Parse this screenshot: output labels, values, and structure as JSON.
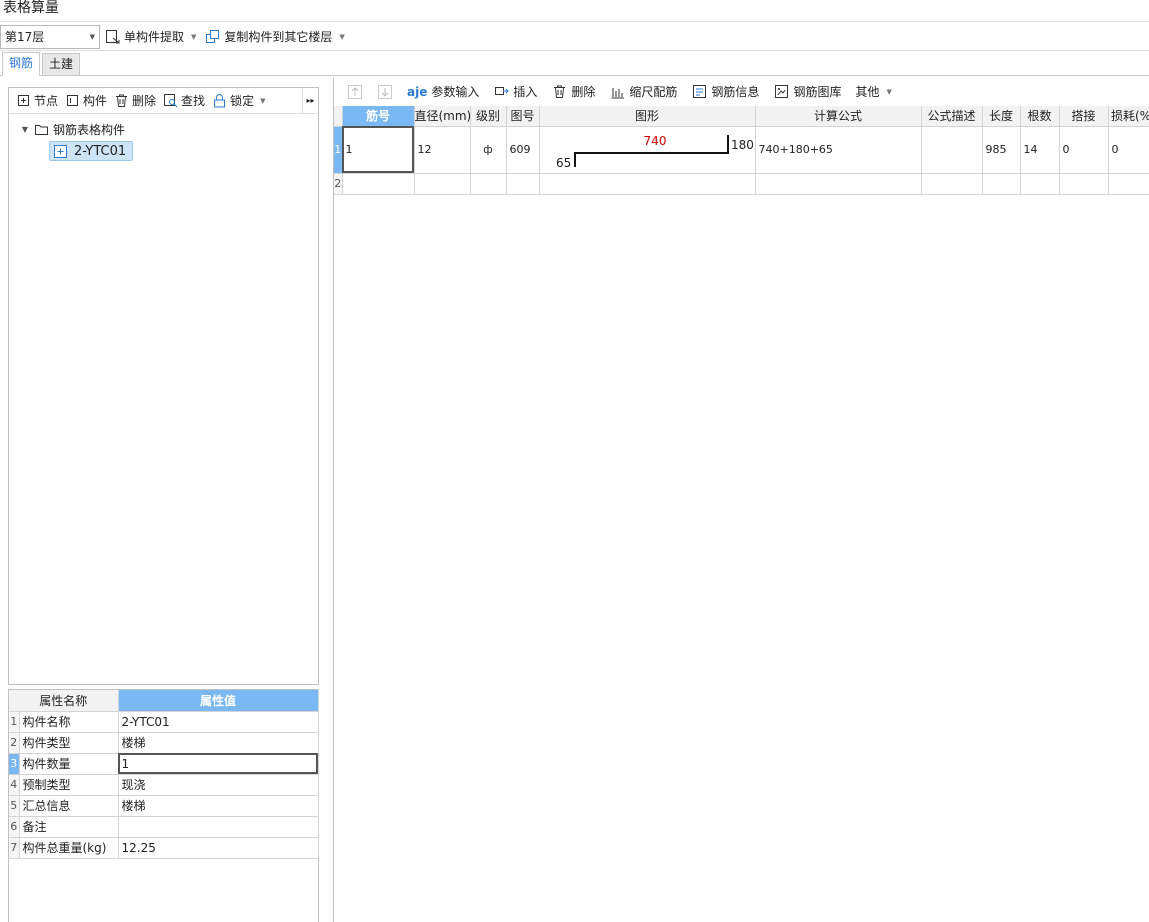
{
  "app": {
    "title": "表格算量"
  },
  "toolbar": {
    "floor": "第17层",
    "extract_label": "单构件提取",
    "copy_label": "复制构件到其它楼层"
  },
  "tabs": [
    {
      "label": "钢筋",
      "active": true
    },
    {
      "label": "土建",
      "active": false
    }
  ],
  "left_toolbar": {
    "node": "节点",
    "component": "构件",
    "delete": "删除",
    "find": "查找",
    "lock": "锁定"
  },
  "tree": {
    "root": "钢筋表格构件",
    "child": "2-YTC01"
  },
  "properties": {
    "headers": [
      "属性名称",
      "属性值"
    ],
    "rows": [
      {
        "n": "1",
        "name": "构件名称",
        "value": "2-YTC01"
      },
      {
        "n": "2",
        "name": "构件类型",
        "value": "楼梯"
      },
      {
        "n": "3",
        "name": "构件数量",
        "value": "1"
      },
      {
        "n": "4",
        "name": "预制类型",
        "value": "现浇"
      },
      {
        "n": "5",
        "name": "汇总信息",
        "value": "楼梯"
      },
      {
        "n": "6",
        "name": "备注",
        "value": ""
      },
      {
        "n": "7",
        "name": "构件总重量(kg)",
        "value": "12.25"
      }
    ]
  },
  "right_toolbar": {
    "param_input": "参数输入",
    "insert": "插入",
    "delete": "删除",
    "scale_rebar": "缩尺配筋",
    "rebar_info": "钢筋信息",
    "rebar_library": "钢筋图库",
    "other": "其他"
  },
  "grid": {
    "headers": [
      "筋号",
      "直径(mm)",
      "级别",
      "图号",
      "图形",
      "计算公式",
      "公式描述",
      "长度",
      "根数",
      "搭接",
      "损耗(%"
    ],
    "rows": [
      {
        "n": "1",
        "bar_no": "1",
        "diameter": "12",
        "grade": "ф",
        "fig_no": "609",
        "shape": {
          "top": "740",
          "right": "180",
          "left": "65"
        },
        "formula": "740+180+65",
        "desc": "",
        "length": "985",
        "count": "14",
        "lap": "0",
        "loss": "0"
      },
      {
        "n": "2"
      }
    ]
  },
  "colors": {
    "accent": "#79b8f2",
    "tab_active": "#2b7bd6",
    "shape_dim": "#cc0000"
  }
}
